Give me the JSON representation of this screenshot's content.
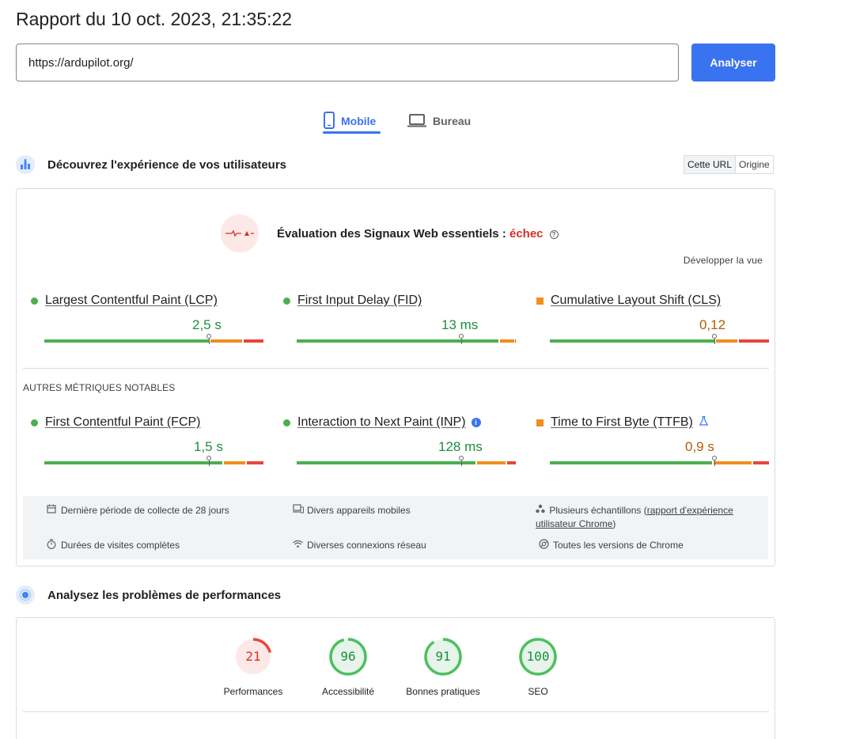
{
  "report": {
    "title": "Rapport du 10 oct. 2023, 21:35:22"
  },
  "search": {
    "url_value": "https://ardupilot.org/",
    "analyze_label": "Analyser"
  },
  "tabs": [
    {
      "label": "Mobile",
      "icon": "smartphone-icon",
      "active": true
    },
    {
      "label": "Bureau",
      "icon": "laptop-icon",
      "active": false
    }
  ],
  "users_section": {
    "title": "Découvrez l'expérience de vos utilisateurs",
    "toggle": [
      "Cette URL",
      "Origine"
    ],
    "assessment_prefix": "Évaluation des Signaux Web essentiels : ",
    "assessment_result": "échec",
    "expand_label": "Développer la vue",
    "other_metrics_label": "AUTRES MÉTRIQUES NOTABLES",
    "core_metrics": [
      {
        "name": "Largest Contentful Paint (LCP)",
        "value": "2,5 s",
        "status": "good"
      },
      {
        "name": "First Input Delay (FID)",
        "value": "13 ms",
        "status": "good"
      },
      {
        "name": "Cumulative Layout Shift (CLS)",
        "value": "0,12",
        "status": "needs-improvement"
      }
    ],
    "other_metrics": [
      {
        "name": "First Contentful Paint (FCP)",
        "value": "1,5 s",
        "status": "good"
      },
      {
        "name": "Interaction to Next Paint (INP)",
        "value": "128 ms",
        "status": "good",
        "badge": "info-icon"
      },
      {
        "name": "Time to First Byte (TTFB)",
        "value": "0,9 s",
        "status": "needs-improvement",
        "badge": "flask-icon"
      }
    ],
    "info_items": [
      {
        "icon": "calendar-icon",
        "text": "Dernière période de collecte de 28 jours"
      },
      {
        "icon": "devices-icon",
        "text": "Divers appareils mobiles"
      },
      {
        "icon": "samples-icon",
        "text_before": "Plusieurs échantillons (",
        "link": "rapport d'expérience utilisateur Chrome",
        "text_after": ")"
      },
      {
        "icon": "timer-icon",
        "text": "Durées de visites complètes"
      },
      {
        "icon": "wifi-icon",
        "text": "Diverses connexions réseau"
      },
      {
        "icon": "chrome-icon",
        "text": "Toutes les versions de Chrome"
      }
    ]
  },
  "perf_section": {
    "title": "Analysez les problèmes de performances",
    "scores": [
      {
        "label": "Performances",
        "value": "21",
        "color": "#d93025",
        "fraction": 0.21
      },
      {
        "label": "Accessibilité",
        "value": "96",
        "color": "#1e8e3e",
        "fraction": 0.96
      },
      {
        "label": "Bonnes pratiques",
        "value": "91",
        "color": "#1e8e3e",
        "fraction": 0.91
      },
      {
        "label": "SEO",
        "value": "100",
        "color": "#1e8e3e",
        "fraction": 1.0
      }
    ]
  },
  "colors": {
    "accent": "#3a73f0",
    "good": "#1e8e3e",
    "average": "#ef8f1d",
    "poor": "#e8453c"
  }
}
